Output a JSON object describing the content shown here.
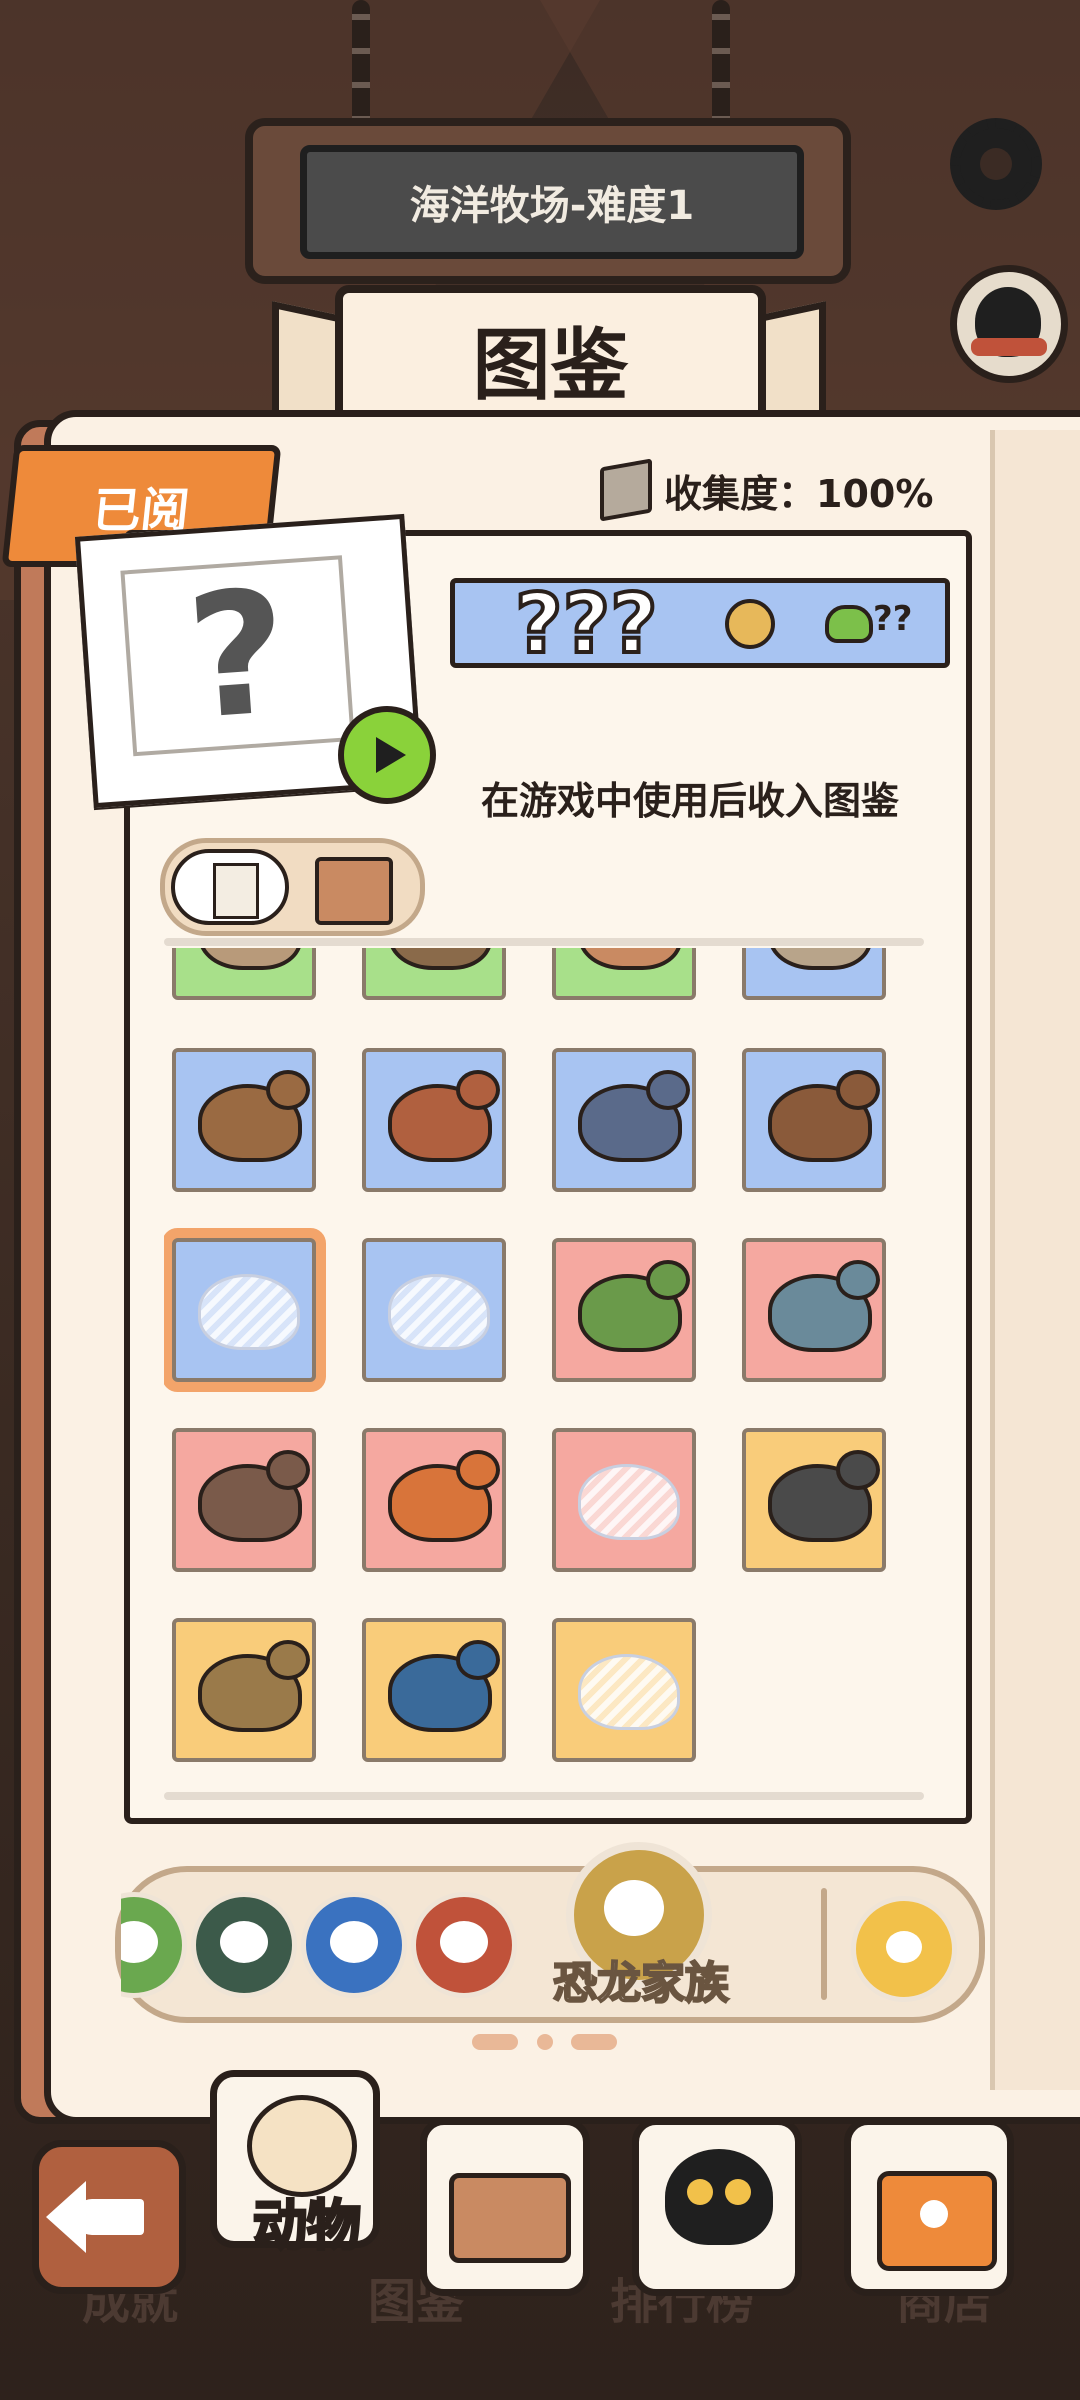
{
  "header": {
    "level_name": "海洋牧场-难度1",
    "title": "图鉴"
  },
  "book": {
    "read_tab": "已阅",
    "collection_label": "收集度：100%"
  },
  "detail": {
    "card_symbol": "?",
    "name": "???",
    "frog_value": "??",
    "hint": "在游戏中使用后收入图鉴"
  },
  "grid": {
    "rows": [
      [
        {
          "bg": "#a8e08a",
          "dino": "#b89a7a",
          "state": "partial"
        },
        {
          "bg": "#a8e08a",
          "dino": "#8a6a4a",
          "state": "partial"
        },
        {
          "bg": "#a8e08a",
          "dino": "#c98a62",
          "state": "partial"
        },
        {
          "bg": "#a8c4f2",
          "dino": "#b8a48a",
          "state": "partial"
        }
      ],
      [
        {
          "bg": "#a8c4f2",
          "dino": "#9a6a42",
          "state": "found"
        },
        {
          "bg": "#a8c4f2",
          "dino": "#b0603f",
          "state": "found"
        },
        {
          "bg": "#a8c4f2",
          "dino": "#5a6a8a",
          "state": "found"
        },
        {
          "bg": "#a8c4f2",
          "dino": "#8a5a3a",
          "state": "found"
        }
      ],
      [
        {
          "bg": "#a8c4f2",
          "dino": "#ffffff",
          "state": "silhouette",
          "selected": true
        },
        {
          "bg": "#a8c4f2",
          "dino": "#ffffff",
          "state": "silhouette"
        },
        {
          "bg": "#f5a8a0",
          "dino": "#6a9a4a",
          "state": "found"
        },
        {
          "bg": "#f5a8a0",
          "dino": "#6a8a9a",
          "state": "found"
        }
      ],
      [
        {
          "bg": "#f5a8a0",
          "dino": "#7a5a4a",
          "state": "found"
        },
        {
          "bg": "#f5a8a0",
          "dino": "#d8743a",
          "state": "found"
        },
        {
          "bg": "#f5a8a0",
          "dino": "#ffffff",
          "state": "silhouette"
        },
        {
          "bg": "#f9cc7a",
          "dino": "#4a4a4a",
          "state": "found"
        }
      ],
      [
        {
          "bg": "#f9cc7a",
          "dino": "#9a7a4a",
          "state": "found"
        },
        {
          "bg": "#f9cc7a",
          "dino": "#3a6a9a",
          "state": "found"
        },
        {
          "bg": "#f9cc7a",
          "dino": "#ffffff",
          "state": "silhouette"
        }
      ]
    ]
  },
  "categories": {
    "icons": [
      "green-partial-icon",
      "dark-green-paw-icon",
      "blue-fish-icon",
      "red-bag-icon"
    ],
    "selected_label": "恐龙家族",
    "colors": [
      "#6aa84f",
      "#3c5a4a",
      "#3a72c0",
      "#c0523a"
    ]
  },
  "nav": {
    "animals_label": "动物",
    "ghost_achievements": "成就",
    "ghost_book": "图鉴",
    "ghost_rank": "排行榜",
    "ghost_shop": "商店"
  },
  "colors": {
    "accent_orange": "#ee8a3a",
    "outline": "#2a201b",
    "paper": "#fbf1e4"
  }
}
